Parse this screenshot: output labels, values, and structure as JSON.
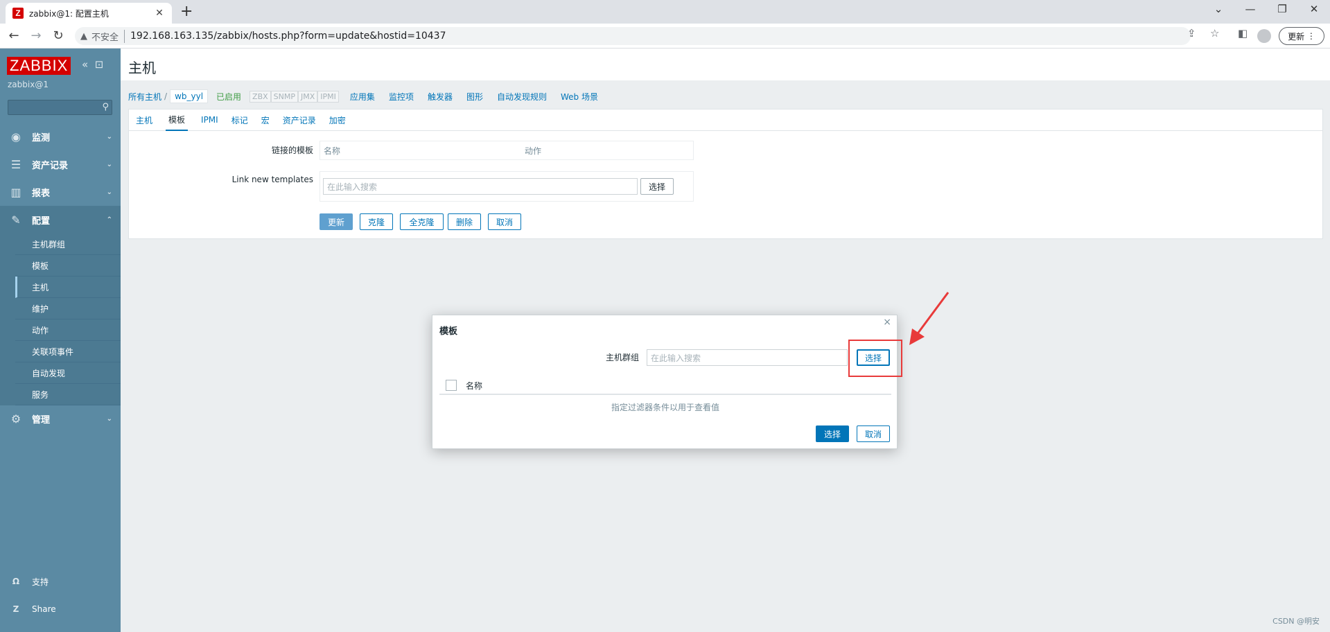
{
  "browser": {
    "tab_title": "zabbix@1: 配置主机",
    "favicon_letter": "Z",
    "insecure_label": "不安全",
    "url": "192.168.163.135/zabbix/hosts.php?form=update&hostid=10437",
    "update_label": "更新"
  },
  "sidebar": {
    "logo": "ZABBIX",
    "server_name": "zabbix@1",
    "menu": [
      {
        "label": "监测"
      },
      {
        "label": "资产记录"
      },
      {
        "label": "报表"
      },
      {
        "label": "配置"
      },
      {
        "label": "管理"
      }
    ],
    "submenu": [
      {
        "label": "主机群组"
      },
      {
        "label": "模板"
      },
      {
        "label": "主机"
      },
      {
        "label": "维护"
      },
      {
        "label": "动作"
      },
      {
        "label": "关联项事件"
      },
      {
        "label": "自动发现"
      },
      {
        "label": "服务"
      }
    ],
    "support": "支持",
    "share": "Share"
  },
  "page": {
    "title": "主机",
    "breadcrumbs": {
      "all_hosts": "所有主机",
      "host": "wb_yyl",
      "enabled": "已启用",
      "protocols": [
        "ZBX",
        "SNMP",
        "JMX",
        "IPMI"
      ],
      "links": [
        "应用集",
        "监控项",
        "触发器",
        "图形",
        "自动发现规则",
        "Web 场景"
      ]
    },
    "tabs": [
      "主机",
      "模板",
      "IPMI",
      "标记",
      "宏",
      "资产记录",
      "加密"
    ],
    "form": {
      "linked_templates_label": "链接的模板",
      "col_name": "名称",
      "col_action": "动作",
      "link_new_label": "Link new templates",
      "search_placeholder": "在此输入搜索",
      "select_btn": "选择",
      "buttons": {
        "update": "更新",
        "clone": "克隆",
        "full_clone": "全克隆",
        "delete": "删除",
        "cancel": "取消"
      }
    }
  },
  "modal": {
    "title": "模板",
    "close": "×",
    "host_group_label": "主机群组",
    "search_placeholder": "在此输入搜索",
    "select_btn": "选择",
    "col_name": "名称",
    "empty_message": "指定过滤器条件以用于查看值",
    "footer_select": "选择",
    "footer_cancel": "取消"
  },
  "watermark": "CSDN @明安",
  "colors": {
    "sidebar": "#5b8aa3",
    "accent": "#0275b8",
    "annotation": "#e83a3a"
  }
}
